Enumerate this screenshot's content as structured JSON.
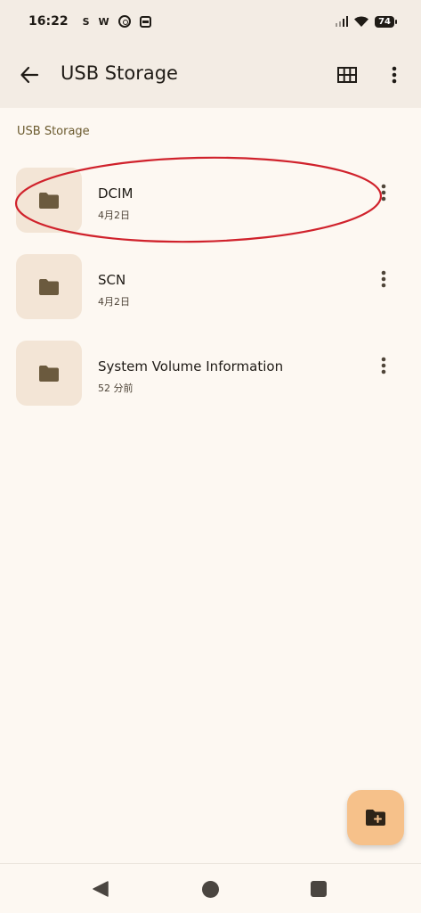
{
  "status_bar": {
    "time": "16:22",
    "app_icons": [
      "S",
      "W"
    ],
    "battery": "74"
  },
  "app_bar": {
    "title": "USB Storage",
    "back_icon": "arrow-back-icon",
    "view_toggle_icon": "grid-view-icon",
    "overflow_icon": "more-vert-icon"
  },
  "breadcrumb": "USB Storage",
  "files": [
    {
      "name": "DCIM",
      "date": "4月2日",
      "icon": "folder-icon"
    },
    {
      "name": "SCN",
      "date": "4月2日",
      "icon": "folder-icon"
    },
    {
      "name": "System Volume Information",
      "date": "52 分前",
      "icon": "folder-icon"
    }
  ],
  "fab": {
    "icon": "create-new-folder-icon"
  },
  "colors": {
    "background": "#fdf8f2",
    "app_bar": "#f3ece4",
    "folder_tile": "#f3e5d6",
    "folder_icon": "#6b5a3e",
    "fab": "#f6c18a",
    "annotation": "#d0222c"
  }
}
